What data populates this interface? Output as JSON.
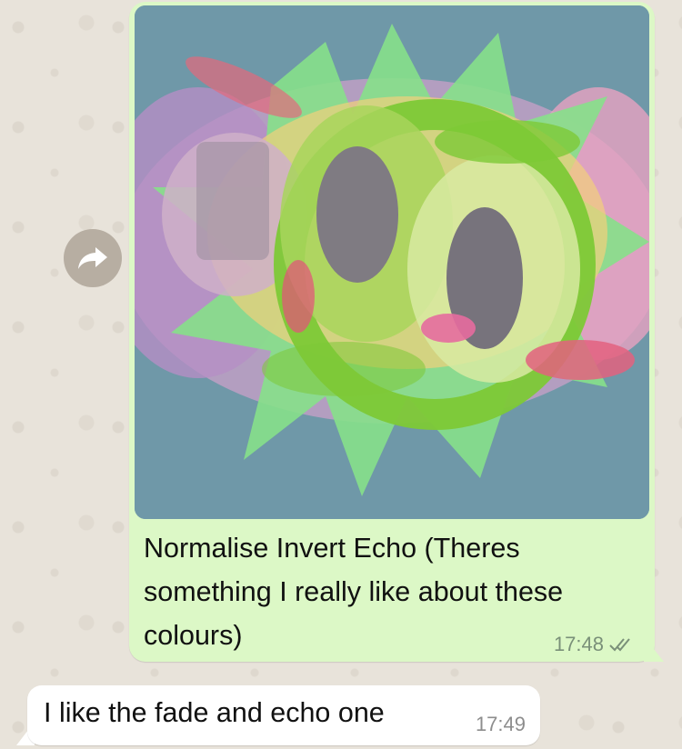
{
  "messages": [
    {
      "direction": "outgoing",
      "type": "image",
      "caption": "Normalise Invert Echo (Theres something I really like about these colours)",
      "time": "17:48",
      "status": "read-double-check",
      "bubble_color": "#dcf8c6"
    },
    {
      "direction": "incoming",
      "type": "text",
      "text": "I like the fade and echo one",
      "time": "17:49",
      "bubble_color": "#ffffff"
    }
  ],
  "forward_button": {
    "icon": "forward-arrow-icon",
    "color": "#b7aea2"
  },
  "wallpaper": {
    "color": "#e8e3da"
  }
}
